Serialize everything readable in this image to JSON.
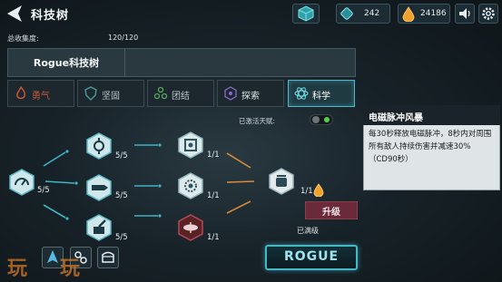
{
  "header": {
    "title": "科技树",
    "resource_1_value": "242",
    "resource_2_value": "24186"
  },
  "collection": {
    "label": "总收集度:",
    "value": "120/120"
  },
  "tree_name": "Rogue科技树",
  "tabs": [
    {
      "label": "勇气",
      "icon": "flame-icon",
      "active": false
    },
    {
      "label": "坚固",
      "icon": "shield-icon",
      "active": false
    },
    {
      "label": "团结",
      "icon": "cluster-icon",
      "active": false
    },
    {
      "label": "探索",
      "icon": "hexagon-star-icon",
      "active": false
    },
    {
      "label": "科学",
      "icon": "atom-icon",
      "active": true
    }
  ],
  "activated_talent_label": "已激活天赋:",
  "nodes": {
    "root_level": "5/5",
    "tier2_top_level": "5/5",
    "tier2_mid_level": "5/5",
    "tier2_bot_level": "5/5",
    "tier3_top_level": "1/1",
    "tier3_mid_level": "1/1",
    "tier3_bot_level": "1/1",
    "final_level": "1/1"
  },
  "info": {
    "title": "电磁脉冲风暴",
    "description": "每30秒释放电磁脉冲，8秒内对周围所有敌人持续伤害并减速30%（CD90秒）"
  },
  "upgrade_label": "升级",
  "maxed_label": "已满级",
  "rogue_button_label": "ROGUE",
  "watermark": [
    "玩",
    "玩"
  ],
  "colors": {
    "accent_cyan": "#4fb8c8",
    "upgrade_red": "#6b2a39",
    "gold": "#f2a22c"
  }
}
